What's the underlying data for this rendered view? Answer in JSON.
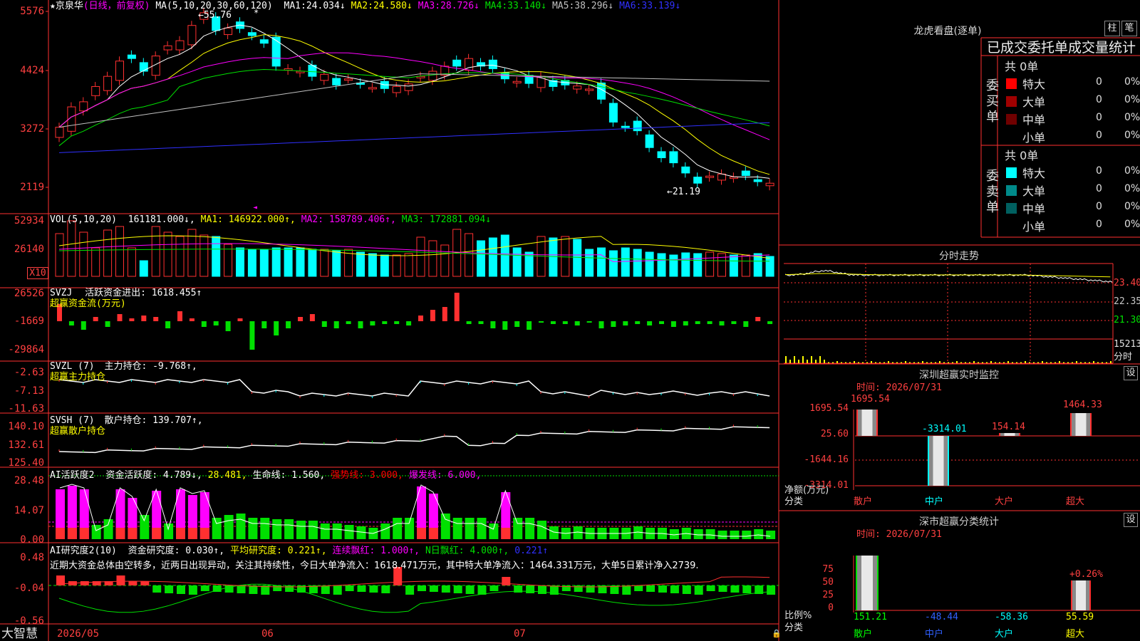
{
  "stock": {
    "star": "★",
    "name": "京泉华",
    "period": "(日线，前复权)",
    "ma_text": "MA(5,10,20,30,60,120)",
    "mas": [
      {
        "label": "MA1:",
        "value": "24.034",
        "arrow": "↓",
        "color": "#ffffff"
      },
      {
        "label": "MA2:",
        "value": "24.580",
        "arrow": "↓",
        "color": "#ffff00"
      },
      {
        "label": "MA3:",
        "value": "28.726",
        "arrow": "↓",
        "color": "#ff00ff"
      },
      {
        "label": "MA4:",
        "value": "33.140",
        "arrow": "↓",
        "color": "#00e000"
      },
      {
        "label": "MA5:",
        "value": "38.296",
        "arrow": "↓",
        "color": "#c0c0c0"
      },
      {
        "label": "MA6:",
        "value": "33.139",
        "arrow": "↓",
        "color": "#3030ff"
      }
    ],
    "high_mark": "55.76",
    "low_mark": "21.19"
  },
  "price_axis": [
    "5576",
    "4424",
    "3272",
    "2119"
  ],
  "vol": {
    "title": "VOL(5,10,20)",
    "items": [
      {
        "text": "161181.000↓,",
        "color": "#ffffff"
      },
      {
        "text": "MA1: 146922.000↑,",
        "color": "#ffff00"
      },
      {
        "text": "MA2: 158789.406↑,",
        "color": "#ff00ff"
      },
      {
        "text": "MA3: 172881.094↓",
        "color": "#00e000"
      }
    ],
    "axis": [
      "52934",
      "26140"
    ],
    "unit": "X10"
  },
  "svzj": {
    "title": "SVZJ",
    "label": "活跃资金进出:",
    "value": "1618.455↑",
    "sub": "超赢资金流(万元)",
    "axis": [
      "26526",
      "-1669",
      "-29864"
    ]
  },
  "svzl": {
    "title": "SVZL (7)",
    "label": "主力持仓:",
    "value": "-9.768↑,",
    "sub": "超赢主力持仓",
    "axis": [
      "-2.63",
      "-7.13",
      "-11.63"
    ]
  },
  "svsh": {
    "title": "SVSH (7)",
    "label": "散户持仓:",
    "value": "139.707↑,",
    "sub": "超赢散户持仓",
    "axis": [
      "140.10",
      "132.61",
      "125.40"
    ]
  },
  "ai1": {
    "title": "AI活跃度2",
    "items": [
      {
        "text": "资金活跃度: 4.789↓,",
        "color": "#ffffff"
      },
      {
        "text": "28.481,",
        "color": "#ffff00"
      },
      {
        "text": "生命线: 1.560,",
        "color": "#ffffff"
      },
      {
        "text": "强势线: 3.000,",
        "color": "#ff0000"
      },
      {
        "text": "爆发线: 6.000,",
        "color": "#ff00ff"
      }
    ],
    "axis": [
      "28.48",
      "14.07",
      "0.00"
    ]
  },
  "ai2": {
    "title": "AI研究度2(10)",
    "items": [
      {
        "text": "资金研究度: 0.030↑,",
        "color": "#ffffff"
      },
      {
        "text": "平均研究度: 0.221↑,",
        "color": "#ffff00"
      },
      {
        "text": "连续飘红: 1.000↑,",
        "color": "#ff00ff"
      },
      {
        "text": "N日飘红: 4.000↑,",
        "color": "#00e000"
      },
      {
        "text": "0.221↑",
        "color": "#3030ff"
      }
    ],
    "comment": "近期大资金总体由空转多，近两日出现异动，关注其持续性，今日大单净流入：1618.471万元，其中特大单净流入：1464.331万元，大单5日累计净入2739.",
    "axis": [
      "0.48",
      "-0.04",
      "-0.56"
    ]
  },
  "date_axis": {
    "logo": "大智慧",
    "labels": [
      "2026/05",
      "06",
      "07"
    ]
  },
  "longhu": {
    "title": "龙虎看盘(逐单)",
    "btn1": "柱",
    "btn2": "笔",
    "tabs": "已成交委托单成交量统计",
    "buy_label": "委买单",
    "sell_label": "委卖单",
    "buy_total": "共 0单",
    "sell_total": "共 0单",
    "buy_rows": [
      {
        "name": "特大",
        "count": "0",
        "pct": "0%",
        "color": "#ff0000"
      },
      {
        "name": "大单",
        "count": "0",
        "pct": "0%",
        "color": "#a00000"
      },
      {
        "name": "中单",
        "count": "0",
        "pct": "0%",
        "color": "#700000"
      },
      {
        "name": "小单",
        "count": "0",
        "pct": "0%",
        "color": "#000000"
      }
    ],
    "sell_rows": [
      {
        "name": "特大",
        "count": "0",
        "pct": "0%",
        "color": "#00ffff"
      },
      {
        "name": "大单",
        "count": "0",
        "pct": "0%",
        "color": "#008a8a"
      },
      {
        "name": "中单",
        "count": "0",
        "pct": "0%",
        "color": "#006060"
      },
      {
        "name": "小单",
        "count": "0",
        "pct": "0%",
        "color": "#000000"
      }
    ]
  },
  "fenshi": {
    "title": "分时走势",
    "axis": [
      "23.40",
      "22.35",
      "21.30",
      "15213",
      "分时"
    ]
  },
  "sz_monitor": {
    "title": "深圳超赢实时监控",
    "btn": "设",
    "time": "时间: 2026/07/31",
    "axis": [
      "1695.54",
      "25.60",
      "-1644.16",
      "-3314.01"
    ],
    "unit1": "净额(万元)",
    "unit2": "分类",
    "bars": [
      {
        "cat": "散户",
        "value": "1695.54",
        "color": "#ff4040"
      },
      {
        "cat": "中户",
        "value": "-3314.01",
        "color": "#00ffff"
      },
      {
        "cat": "大户",
        "value": "154.14",
        "color": "#ff4040"
      },
      {
        "cat": "超大",
        "value": "1464.33",
        "color": "#ff4040"
      }
    ]
  },
  "sz_stats": {
    "title": "深市超赢分类统计",
    "btn": "设",
    "time": "时间: 2026/07/31",
    "axis": [
      "75",
      "50",
      "25",
      "0"
    ],
    "unit1": "比例%",
    "unit2": "分类",
    "pct_label": "+0.26%",
    "bars": [
      {
        "cat": "散户",
        "value": "151.21",
        "color": "#00ff00"
      },
      {
        "cat": "中户",
        "value": "-48.44",
        "color": "#3060ff"
      },
      {
        "cat": "大户",
        "value": "-58.36",
        "color": "#00ffff"
      },
      {
        "cat": "超大",
        "value": "55.59",
        "color": "#ffff00"
      }
    ]
  }
}
